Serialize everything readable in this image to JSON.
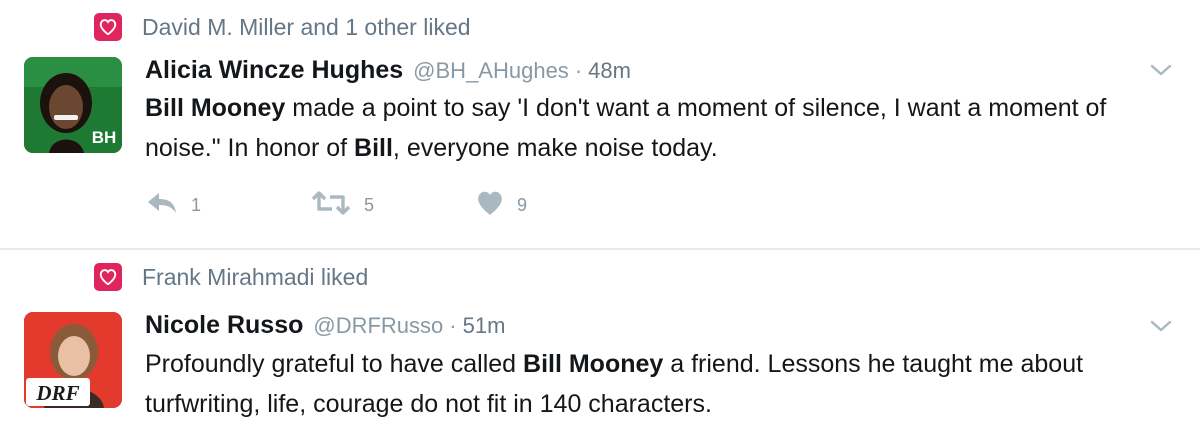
{
  "tweets": [
    {
      "liked_by": "David M. Miller and 1 other liked",
      "avatar_initials": "BH",
      "display_name": "Alicia Wincze Hughes",
      "handle": "@BH_AHughes",
      "separator": "·",
      "time": "48m",
      "text": [
        {
          "t": "Bill Mooney",
          "b": true
        },
        {
          "t": " made a point to say 'I don't want a moment of silence, I want a moment of noise.\" In honor of ",
          "b": false
        },
        {
          "t": "Bill",
          "b": true
        },
        {
          "t": ", everyone make noise today.",
          "b": false
        }
      ],
      "replies": "1",
      "retweets": "5",
      "likes": "9"
    },
    {
      "liked_by": "Frank Mirahmadi liked",
      "avatar_badge": "DRF",
      "display_name": "Nicole Russo",
      "handle": "@DRFRusso",
      "separator": "·",
      "time": "51m",
      "text": [
        {
          "t": "Profoundly grateful to have called ",
          "b": false
        },
        {
          "t": "Bill Mooney",
          "b": true
        },
        {
          "t": " a friend. Lessons he taught me about turfwriting, life, courage do not fit in 140 characters.",
          "b": false
        }
      ]
    }
  ],
  "colors": {
    "like_badge": "#e0245e",
    "muted": "#657786",
    "icon": "#aab8c2",
    "avatar1_bg": "#1e7a33",
    "avatar2_bg": "#e33a2d"
  },
  "icons": [
    "heart-badge-icon",
    "chevron-down-icon",
    "reply-icon",
    "retweet-icon",
    "like-icon"
  ]
}
